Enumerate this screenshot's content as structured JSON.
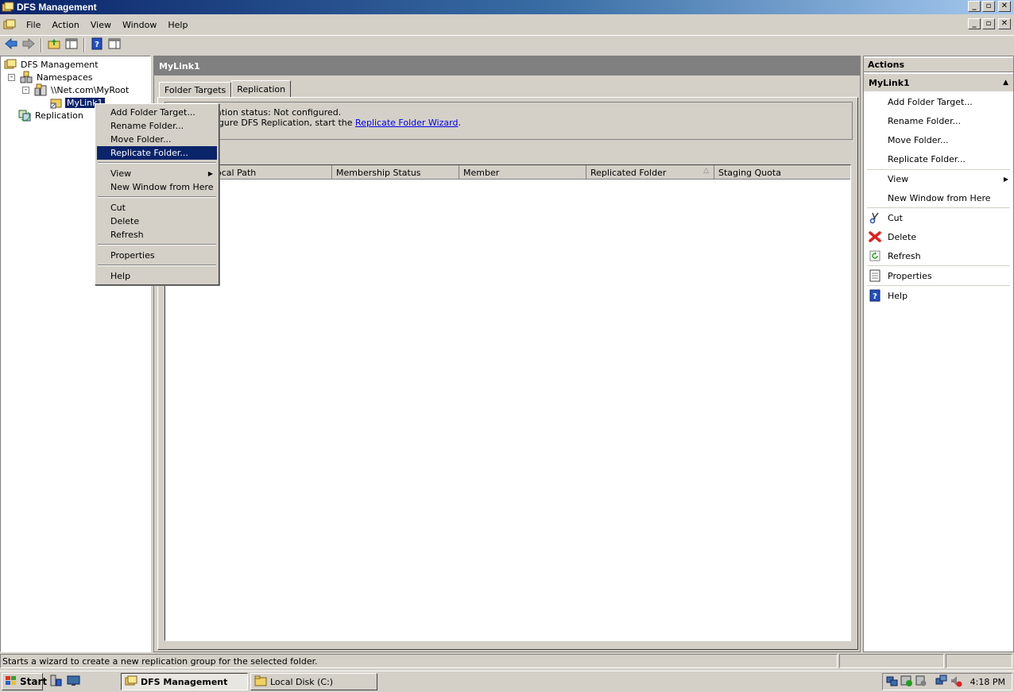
{
  "window": {
    "title": "DFS Management"
  },
  "menu": {
    "items": [
      "File",
      "Action",
      "View",
      "Window",
      "Help"
    ]
  },
  "tree": {
    "root": "DFS Management",
    "namespaces": "Namespaces",
    "namespace_root": "\\\\Net.com\\MyRoot",
    "selected_folder": "MyLink1",
    "replication": "Replication"
  },
  "middle": {
    "header": "MyLink1",
    "tabs": [
      "Folder Targets",
      "Replication"
    ],
    "active_tab": "Replication",
    "status_line": "ation status: Not configured.",
    "wizard_prefix": "figure DFS Replication, start the ",
    "wizard_link": "Replicate Folder Wizard",
    "wizard_suffix": ".",
    "columns": [
      "ocal Path",
      "Membership Status",
      "Member",
      "Replicated Folder",
      "Staging Quota"
    ]
  },
  "context_menu": {
    "items": [
      "Add Folder Target...",
      "Rename Folder...",
      "Move Folder...",
      "Replicate Folder...",
      "View",
      "New Window from Here",
      "Cut",
      "Delete",
      "Refresh",
      "Properties",
      "Help"
    ],
    "highlighted": "Replicate Folder..."
  },
  "actions": {
    "title": "Actions",
    "section": "MyLink1",
    "items": [
      "Add Folder Target...",
      "Rename Folder...",
      "Move Folder...",
      "Replicate Folder...",
      "View",
      "New Window from Here",
      "Cut",
      "Delete",
      "Refresh",
      "Properties",
      "Help"
    ]
  },
  "statusbar": {
    "text": "Starts a wizard to create a new replication group for the selected folder."
  },
  "taskbar": {
    "start": "Start",
    "tasks": [
      "DFS Management",
      "Local Disk (C:)"
    ],
    "clock": "4:18 PM"
  }
}
